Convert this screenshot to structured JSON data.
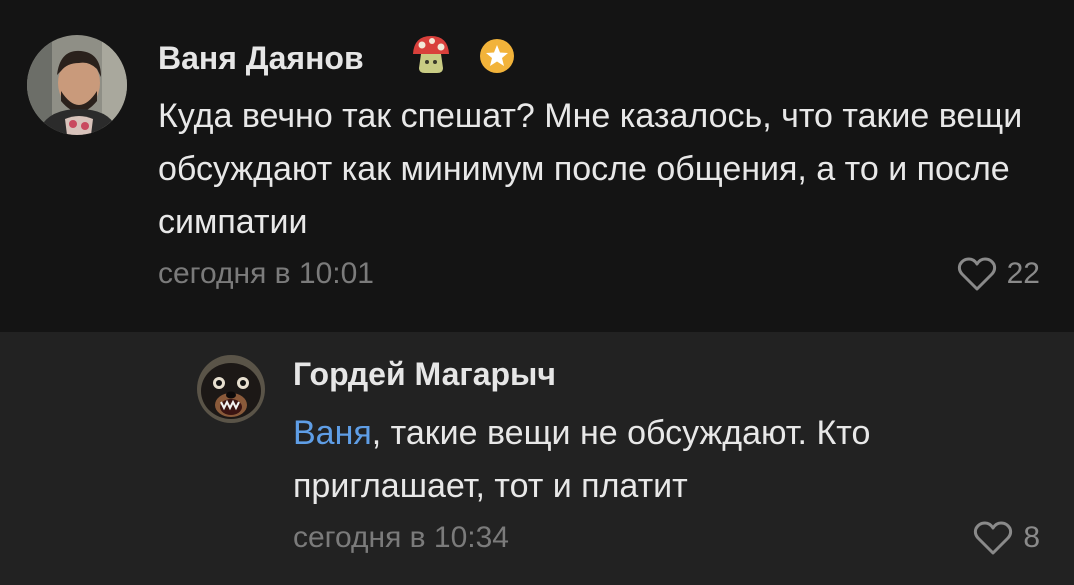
{
  "comments": [
    {
      "author": "Ваня Даянов",
      "text": "Куда вечно так спешат? Мне казалось, что такие вещи обсуждают как минимум после общения, а то и после симпатии",
      "time": "сегодня в 10:01",
      "likes": "22"
    },
    {
      "author": "Гордей Магарыч",
      "mention": "Ваня",
      "text": ", такие вещи не обсуждают. Кто приглашает, тот и платит",
      "time": "сегодня в 10:34",
      "likes": "8"
    }
  ],
  "colors": {
    "background": "#141414",
    "reply_background": "#222222",
    "mention": "#5f9ee6",
    "muted": "#7b7b7b",
    "star_badge": "#f2b33a"
  },
  "icons": {
    "mushroom": "mushroom-emoji-icon",
    "star": "star-badge-icon",
    "heart": "heart-outline-icon"
  }
}
